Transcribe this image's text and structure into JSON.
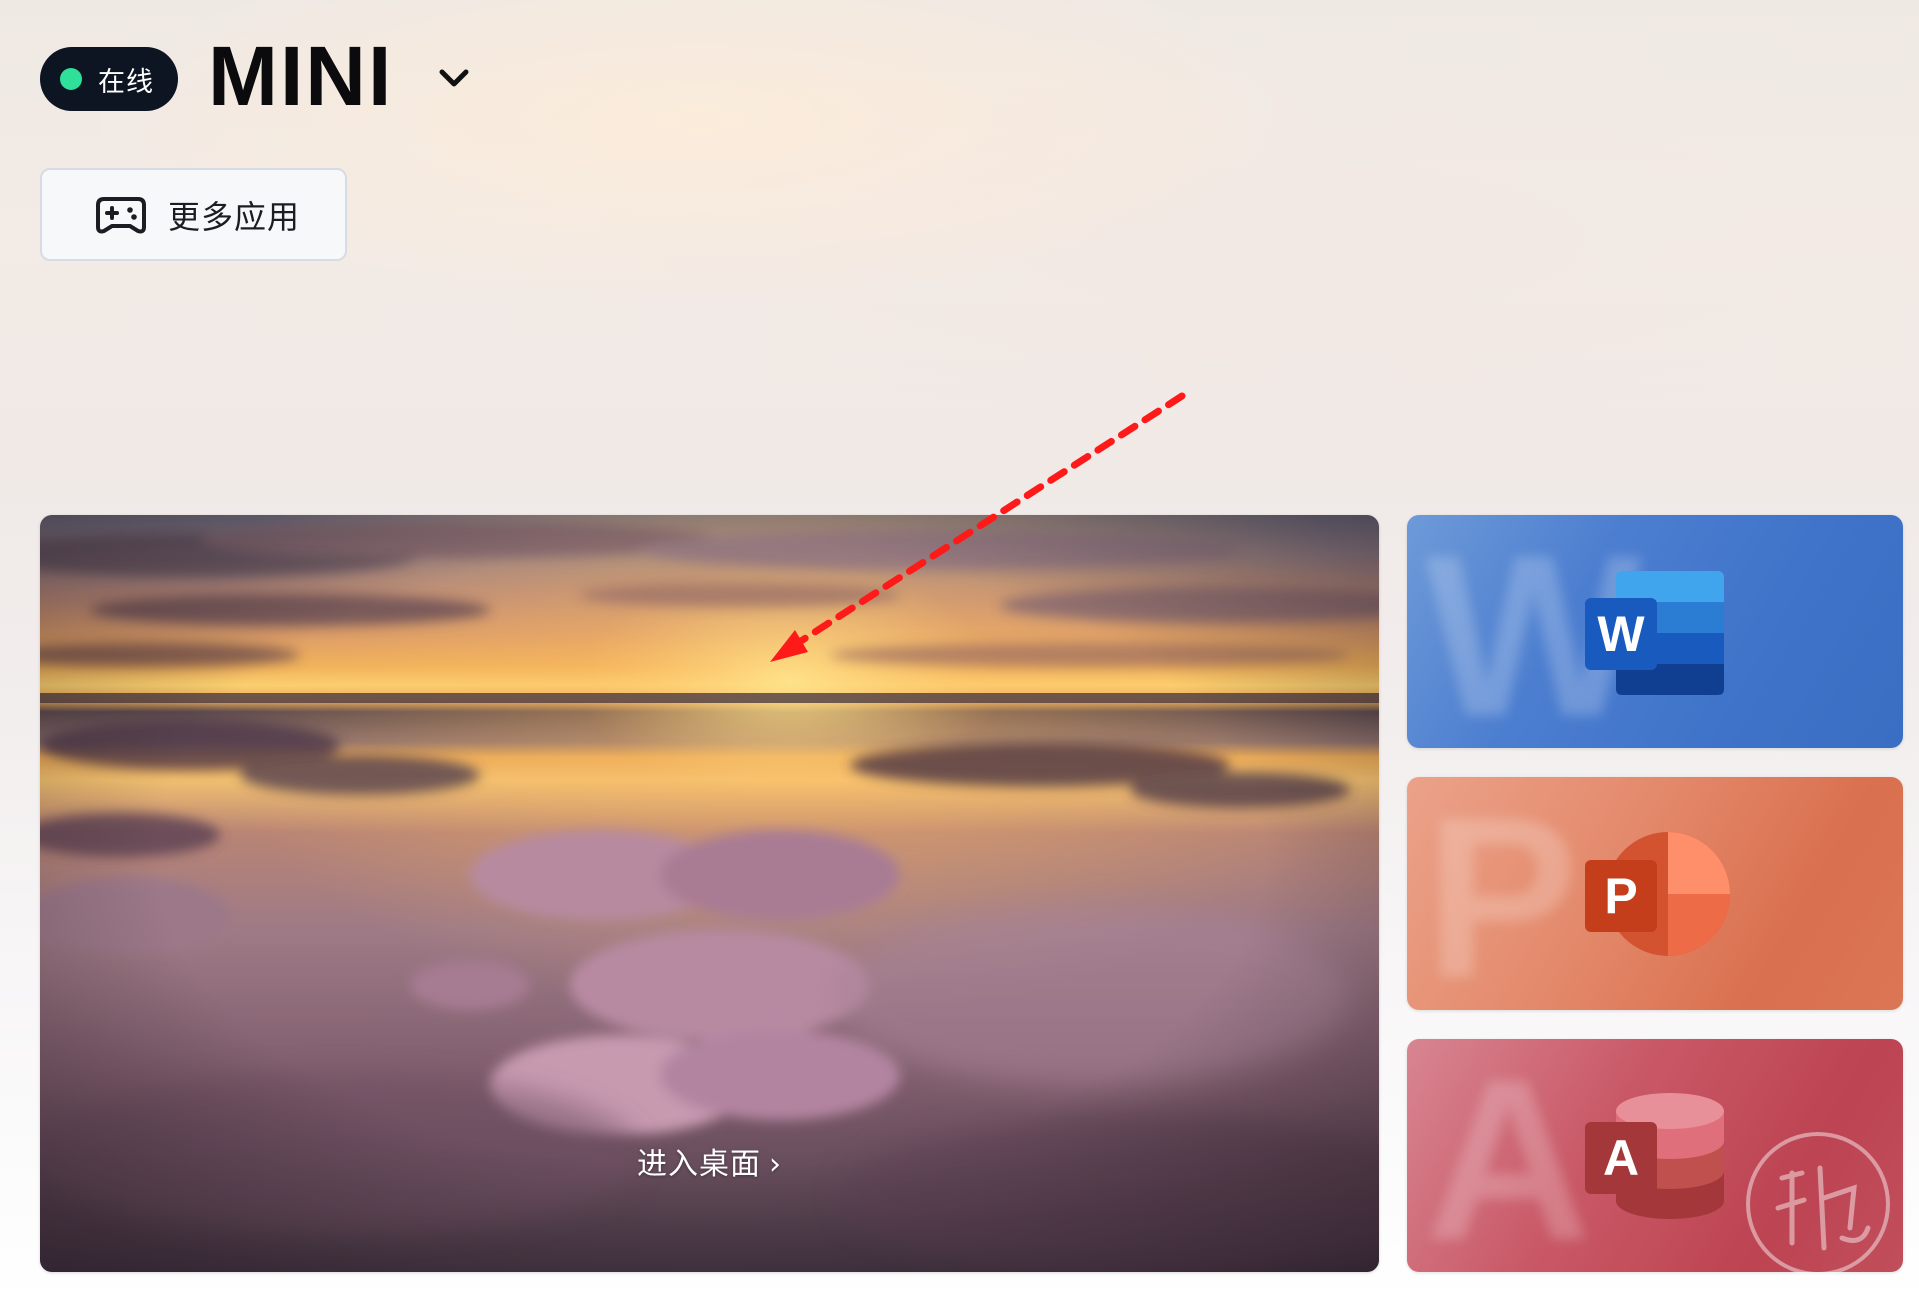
{
  "header": {
    "status_label": "在线",
    "device_name": "MINI",
    "device_chevron_icon": "chevron-down-icon"
  },
  "toolbar": {
    "more_apps_label": "更多应用",
    "more_apps_icon": "gamepad-icon"
  },
  "desktop": {
    "enter_label": "进入桌面",
    "enter_chevron": "›"
  },
  "apps": [
    {
      "name": "Word",
      "letter": "W",
      "accent": "#185abd"
    },
    {
      "name": "PowerPoint",
      "letter": "P",
      "accent": "#c43e1c"
    },
    {
      "name": "Access",
      "letter": "A",
      "accent": "#a4373a"
    }
  ],
  "colors": {
    "status_dot": "#2fe09a",
    "status_pill_bg": "#0d1422",
    "annotation_arrow": "#ff1a1a"
  }
}
